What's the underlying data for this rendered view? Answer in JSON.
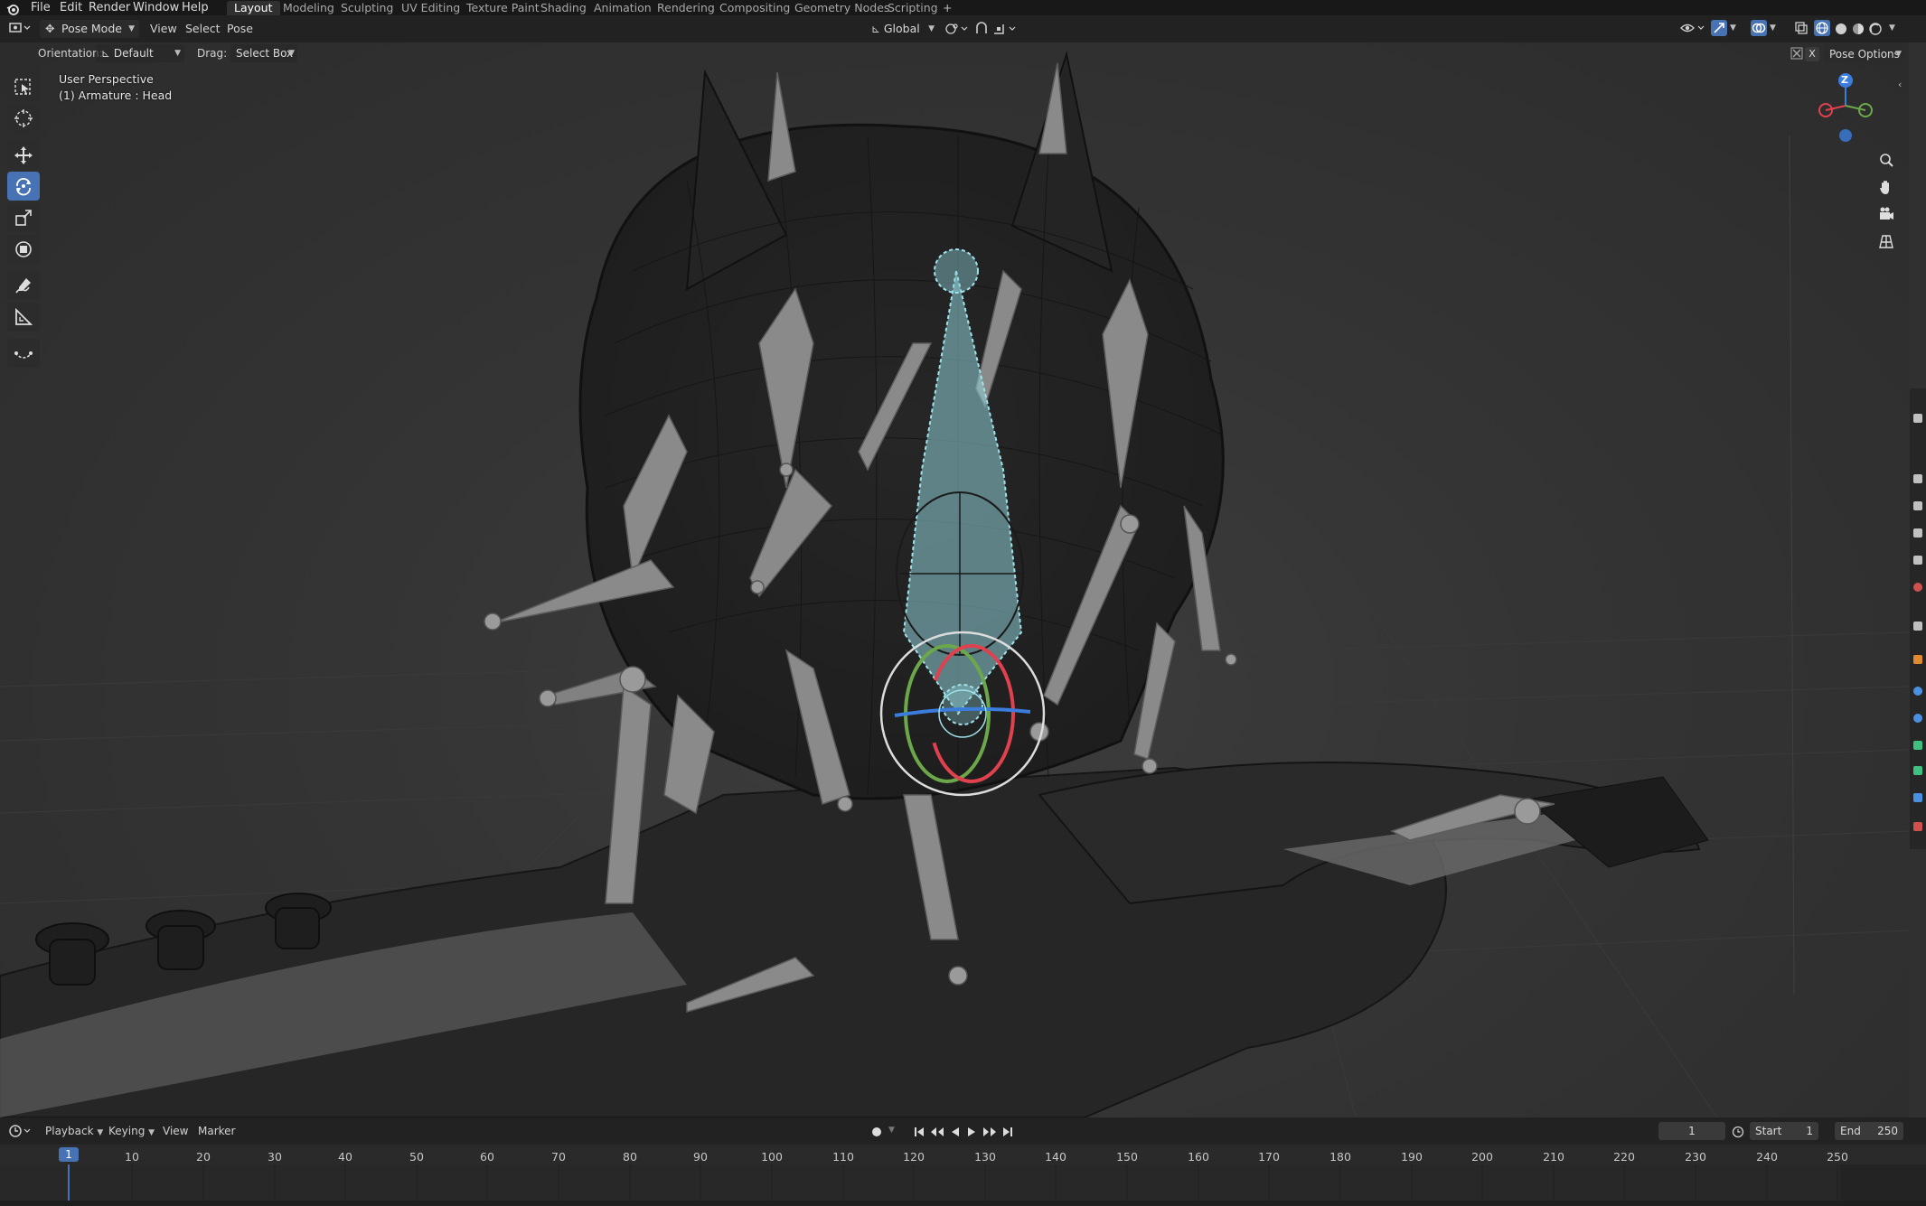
{
  "menu_bar": {
    "items": [
      "File",
      "Edit",
      "Render",
      "Window",
      "Help"
    ],
    "workspaces": [
      "Layout",
      "Modeling",
      "Sculpting",
      "UV Editing",
      "Texture Paint",
      "Shading",
      "Animation",
      "Rendering",
      "Compositing",
      "Geometry Nodes",
      "Scripting"
    ],
    "active_workspace": "Layout",
    "add_label": "+"
  },
  "header": {
    "mode": "Pose Mode",
    "menus": [
      "View",
      "Select",
      "Pose"
    ],
    "transform_orientation": "Global",
    "pose_options_label": "Pose Options",
    "x_label": "X"
  },
  "tool_options": {
    "orientation_label": "Orientation:",
    "orientation_value": "Default",
    "drag_label": "Drag:",
    "drag_value": "Select Box"
  },
  "viewport": {
    "view_name": "User Perspective",
    "active_object": "(1) Armature : Head",
    "gizmo_axes": {
      "z": "Z"
    }
  },
  "timeline": {
    "menus": [
      "Playback",
      "Keying",
      "View",
      "Marker"
    ],
    "current_frame": "1",
    "start_label": "Start",
    "start_value": "1",
    "end_label": "End",
    "end_value": "250",
    "playhead_frame": "1",
    "ticks": [
      "10",
      "20",
      "30",
      "40",
      "50",
      "60",
      "70",
      "80",
      "90",
      "100",
      "110",
      "120",
      "130",
      "140",
      "150",
      "160",
      "170",
      "180",
      "190",
      "200",
      "210",
      "220",
      "230",
      "240",
      "250"
    ]
  },
  "colors": {
    "accent": "#4772b3",
    "selection": "#8fd0d8",
    "axis_x": "#e0414f",
    "axis_y": "#6ca84a",
    "axis_z": "#3b7ddd"
  }
}
